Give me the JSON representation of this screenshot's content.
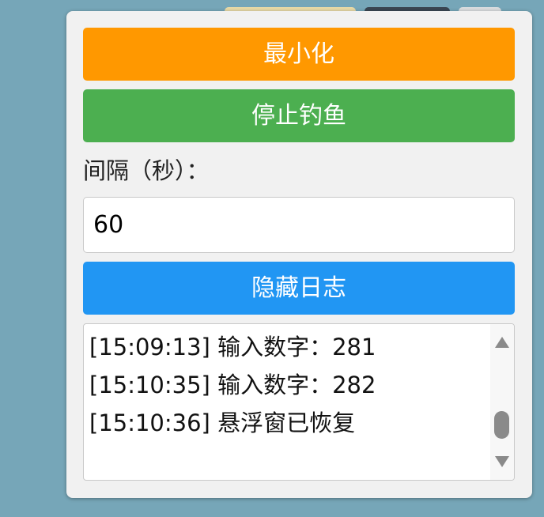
{
  "controls": {
    "minimize_label": "最小化",
    "stop_fishing_label": "停止钓鱼",
    "interval_label": "间隔（秒）：",
    "interval_value": "60",
    "toggle_log_label": "隐藏日志"
  },
  "log": {
    "entries": [
      "[15:09:13] 输入数字：281",
      "[15:10:35] 输入数字：282",
      "[15:10:36] 悬浮窗已恢复"
    ],
    "scroll_position_fraction": 0.85
  },
  "colors": {
    "page_background": "#76a6b8",
    "panel_background": "#f1f1f1",
    "minimize_button": "#ff9800",
    "stop_button": "#4caf50",
    "toggle_log_button": "#2196f3"
  }
}
